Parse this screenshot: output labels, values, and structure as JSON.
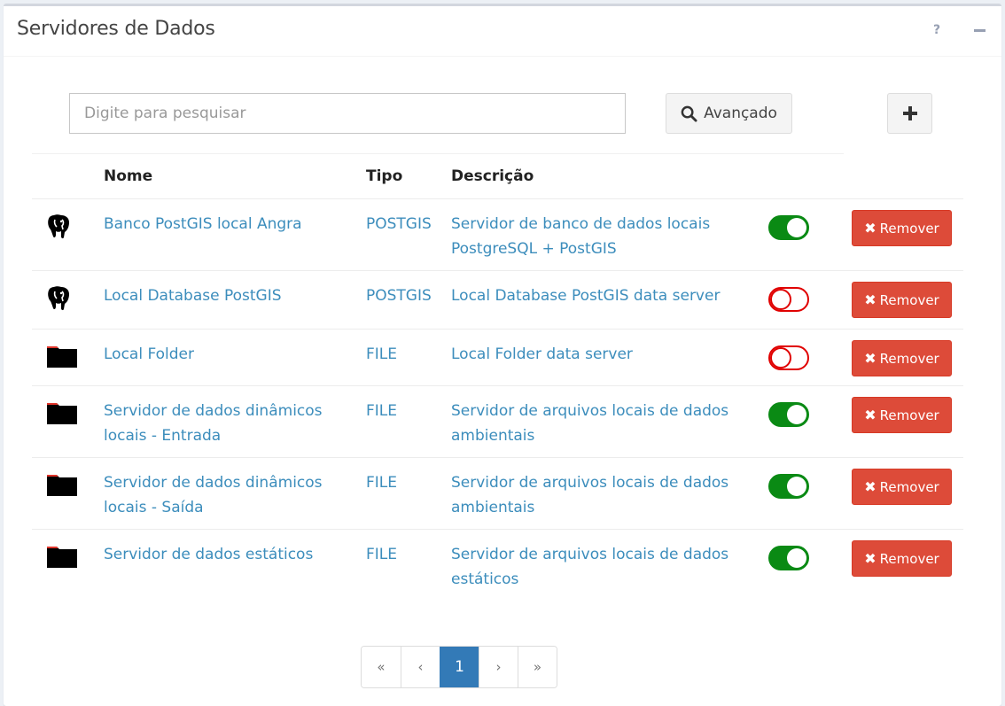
{
  "panel": {
    "title": "Servidores de Dados",
    "help_label": "?",
    "collapse_icon": "minus-icon"
  },
  "search": {
    "placeholder": "Digite para pesquisar",
    "value": "",
    "advanced_label": "Avançado",
    "advanced_icon": "search-icon",
    "add_icon": "plus-icon"
  },
  "table": {
    "columns": [
      "Nome",
      "Tipo",
      "Descrição"
    ],
    "remove_label": "Remover",
    "rows": [
      {
        "icon": "postgresql-elephant-icon",
        "name_line1": "Banco PostGIS local Angra",
        "name_line2": "",
        "type": "POSTGIS",
        "desc_line1": "Servidor de banco de dados locais",
        "desc_line2": "PostgreSQL + PostGIS",
        "active": true
      },
      {
        "icon": "postgresql-elephant-icon",
        "name_line1": "Local Database PostGIS",
        "name_line2": "",
        "type": "POSTGIS",
        "desc_line1": "Local Database PostGIS data server",
        "desc_line2": "",
        "active": false
      },
      {
        "icon": "folder-icon",
        "name_line1": "Local Folder",
        "name_line2": "",
        "type": "FILE",
        "desc_line1": "Local Folder data server",
        "desc_line2": "",
        "active": false
      },
      {
        "icon": "folder-icon",
        "name_line1": "Servidor de dados dinâmicos",
        "name_line2": "locais - Entrada",
        "type": "FILE",
        "desc_line1": "Servidor de arquivos locais de dados",
        "desc_line2": "ambientais",
        "active": true
      },
      {
        "icon": "folder-icon",
        "name_line1": "Servidor de dados dinâmicos",
        "name_line2": "locais - Saída",
        "type": "FILE",
        "desc_line1": "Servidor de arquivos locais de dados",
        "desc_line2": "ambientais",
        "active": true
      },
      {
        "icon": "folder-icon",
        "name_line1": "Servidor de dados estáticos",
        "name_line2": "",
        "type": "FILE",
        "desc_line1": "Servidor de arquivos locais de dados",
        "desc_line2": "estáticos",
        "active": true
      }
    ]
  },
  "pagination": {
    "first": "«",
    "prev": "‹",
    "current": "1",
    "next": "›",
    "last": "»"
  },
  "colors": {
    "link": "#3c8dbc",
    "toggle_on": "#0a8a14",
    "toggle_off": "#e00000",
    "remove_button": "#dd4b39",
    "active_page": "#337ab7"
  }
}
